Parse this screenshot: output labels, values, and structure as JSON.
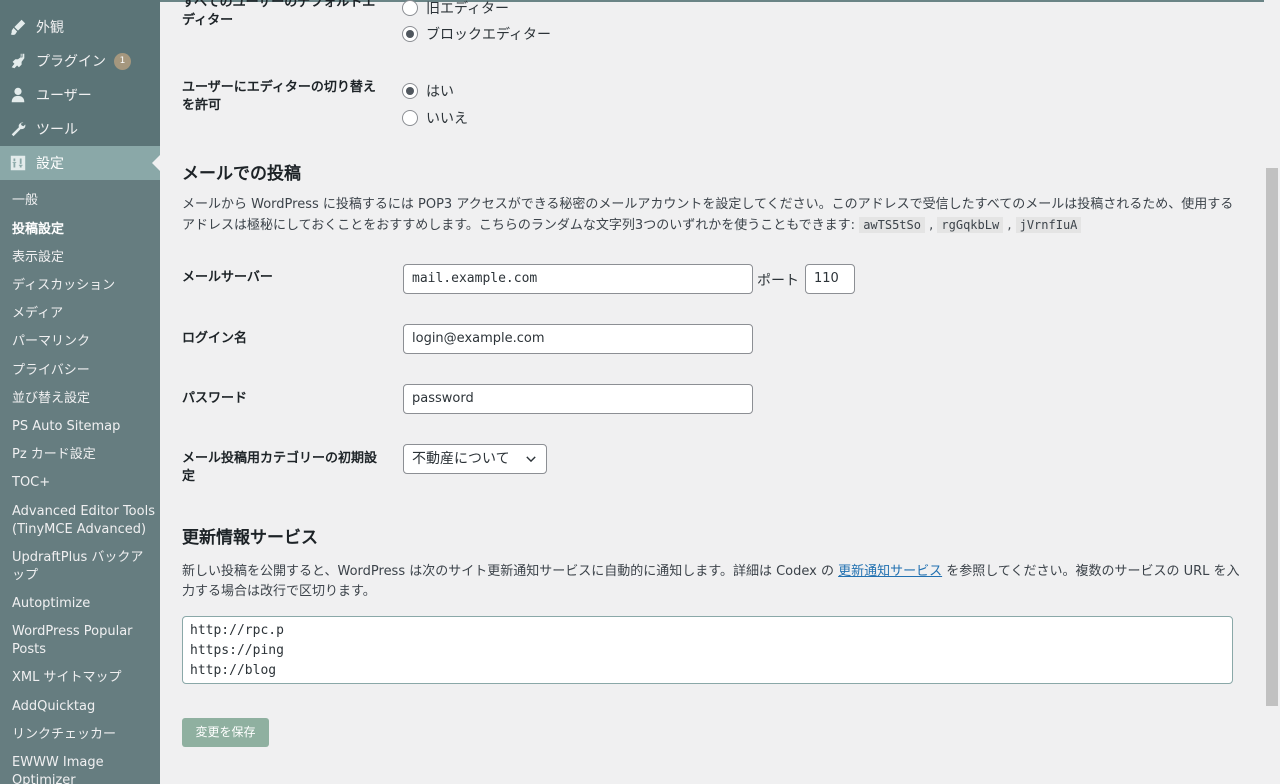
{
  "sidebar": {
    "top_items": [
      {
        "label": "外観",
        "icon": "brush-icon"
      },
      {
        "label": "プラグイン",
        "icon": "plugin-icon",
        "badge": "1"
      },
      {
        "label": "ユーザー",
        "icon": "user-icon"
      },
      {
        "label": "ツール",
        "icon": "wrench-icon"
      },
      {
        "label": "設定",
        "icon": "settings-icon",
        "current": true
      }
    ],
    "submenu": [
      "一般",
      "投稿設定",
      "表示設定",
      "ディスカッション",
      "メディア",
      "パーマリンク",
      "プライバシー",
      "並び替え設定",
      "PS Auto Sitemap",
      "Pz カード設定",
      "TOC+",
      "Advanced Editor Tools (TinyMCE Advanced)",
      "UpdraftPlus バックアップ",
      "Autoptimize",
      "WordPress Popular Posts",
      "XML サイトマップ",
      "AddQuicktag",
      "リンクチェッカー",
      "EWWW Image Optimizer"
    ]
  },
  "editor": {
    "default_editor_label": "すべてのユーザーのデフォルトエディター",
    "classic_option": "旧エディター",
    "block_option": "ブロックエディター",
    "allow_switch_label": "ユーザーにエディターの切り替えを許可",
    "yes_option": "はい",
    "no_option": "いいえ"
  },
  "post_via_email": {
    "heading": "メールでの投稿",
    "desc_part1": "メールから WordPress に投稿するには POP3 アクセスができる秘密のメールアカウントを設定してください。このアドレスで受信したすべてのメールは投稿されるため、使用するアドレスは極秘にしておくことをおすすめします。こちらのランダムな文字列3つのいずれかを使うこともできます: ",
    "codes": [
      "awTS5tSo",
      "rgGqkbLw",
      "jVrnfIuA"
    ],
    "mail_server_label": "メールサーバー",
    "mail_server_value": "mail.example.com",
    "port_label": "ポート",
    "port_value": "110",
    "login_label": "ログイン名",
    "login_value": "login@example.com",
    "password_label": "パスワード",
    "password_value": "password",
    "category_label": "メール投稿用カテゴリーの初期設定",
    "category_value": "不動産について"
  },
  "update_services": {
    "heading": "更新情報サービス",
    "desc_part1": "新しい投稿を公開すると、WordPress は次のサイト更新通知サービスに自動的に通知します。詳細は Codex の ",
    "link_text": "更新通知サービス",
    "desc_part2": " を参照してください。複数のサービスの URL を入力する場合は改行で区切ります。",
    "textarea_value": "http://rpc.p\nhttps://ping\nhttp://blog"
  },
  "save_button": "変更を保存"
}
